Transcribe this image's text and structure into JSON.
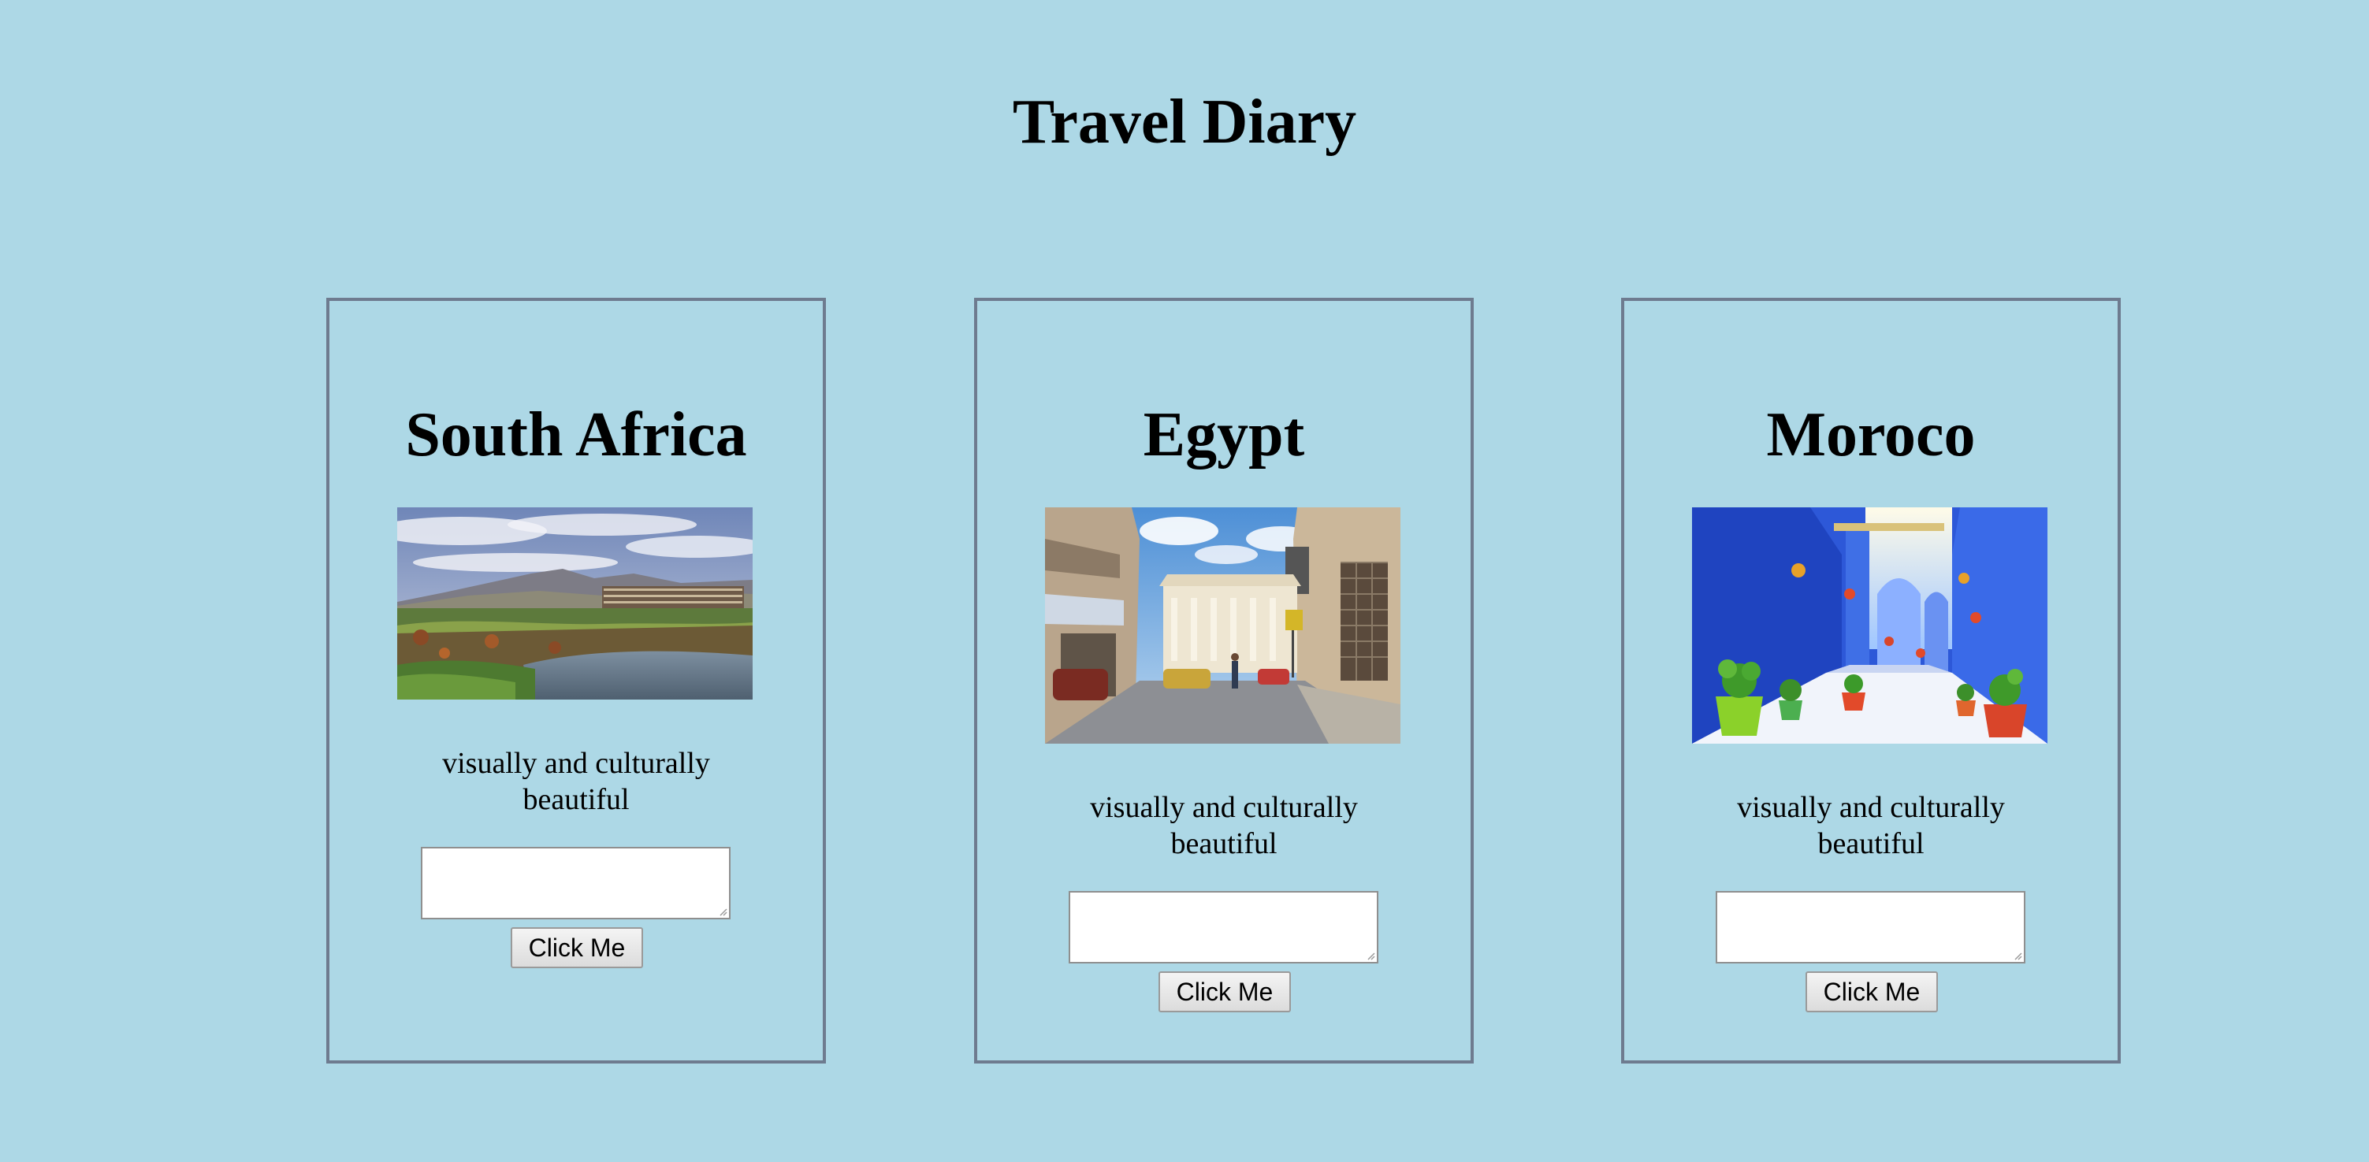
{
  "page": {
    "title": "Travel Diary",
    "background_color": "#add8e6",
    "card_border_color": "#6e7b8f"
  },
  "cards": [
    {
      "title": "South Africa",
      "image_alt": "landscape with hills, golf course and hotel",
      "description": "visually and culturally beautiful",
      "input_value": "",
      "button_label": "Click Me"
    },
    {
      "title": "Egypt",
      "image_alt": "city street with classical building and cars",
      "description": "visually and culturally beautiful",
      "input_value": "",
      "button_label": "Click Me"
    },
    {
      "title": "Moroco",
      "image_alt": "blue painted alley with potted plants",
      "description": "visually and culturally beautiful",
      "input_value": "",
      "button_label": "Click Me"
    }
  ]
}
